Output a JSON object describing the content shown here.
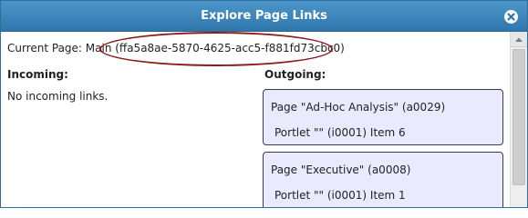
{
  "dialog": {
    "title": "Explore Page Links",
    "close_icon": "close-circle-icon"
  },
  "current_page": {
    "text": "Current Page: Main (ffa5a8ae-5870-4625-acc5-f881fd73cbc0)"
  },
  "incoming": {
    "heading": "Incoming:",
    "empty_text": "No incoming links."
  },
  "outgoing": {
    "heading": "Outgoing:",
    "links": [
      {
        "page": "Page \"Ad-Hoc Analysis\" (a0029)",
        "portlet": "Portlet \"\" (i0001) Item 6"
      },
      {
        "page": "Page \"Executive\" (a0008)",
        "portlet": "Portlet \"\" (i0001) Item 1"
      }
    ]
  },
  "colors": {
    "titlebar": "#3a84bb",
    "link_box_bg": "#eaeaff",
    "highlight_ellipse": "#8b1a1a"
  }
}
